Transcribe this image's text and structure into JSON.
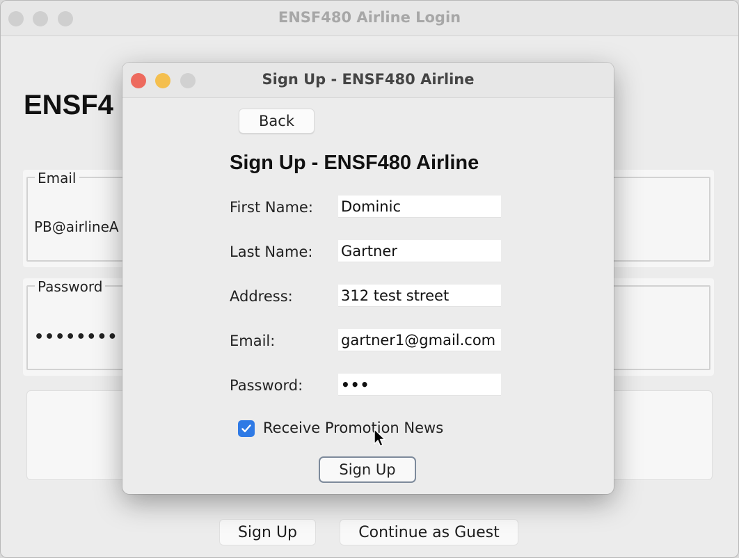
{
  "main_window": {
    "title": "ENSF480 Airline Login",
    "heading": "ENSF4",
    "email_label": "Email",
    "email_value": "PB@airlineA",
    "password_label": "Password",
    "password_value": "••••••••",
    "buttons": {
      "signup": "Sign Up",
      "guest": "Continue as Guest"
    }
  },
  "dialog": {
    "title": "Sign Up - ENSF480 Airline",
    "back_label": "Back",
    "heading": "Sign Up - ENSF480 Airline",
    "fields": {
      "first_name": {
        "label": "First Name:",
        "value": "Dominic"
      },
      "last_name": {
        "label": "Last Name:",
        "value": "Gartner"
      },
      "address": {
        "label": "Address:",
        "value": "312 test street"
      },
      "email": {
        "label": "Email:",
        "value": "gartner1@gmail.com"
      },
      "password": {
        "label": "Password:",
        "value": "•••"
      }
    },
    "promo_checkbox": {
      "label": "Receive Promotion News",
      "checked": true
    },
    "signup_label": "Sign Up"
  },
  "colors": {
    "close": "#ed6a5e",
    "minimize": "#f4bf4f",
    "inactive": "#d1d1d1",
    "checkbox_accent": "#2f7ae5"
  },
  "icons": [
    "close-icon",
    "minimize-icon",
    "zoom-icon",
    "checkmark-icon",
    "mouse-cursor-icon"
  ]
}
